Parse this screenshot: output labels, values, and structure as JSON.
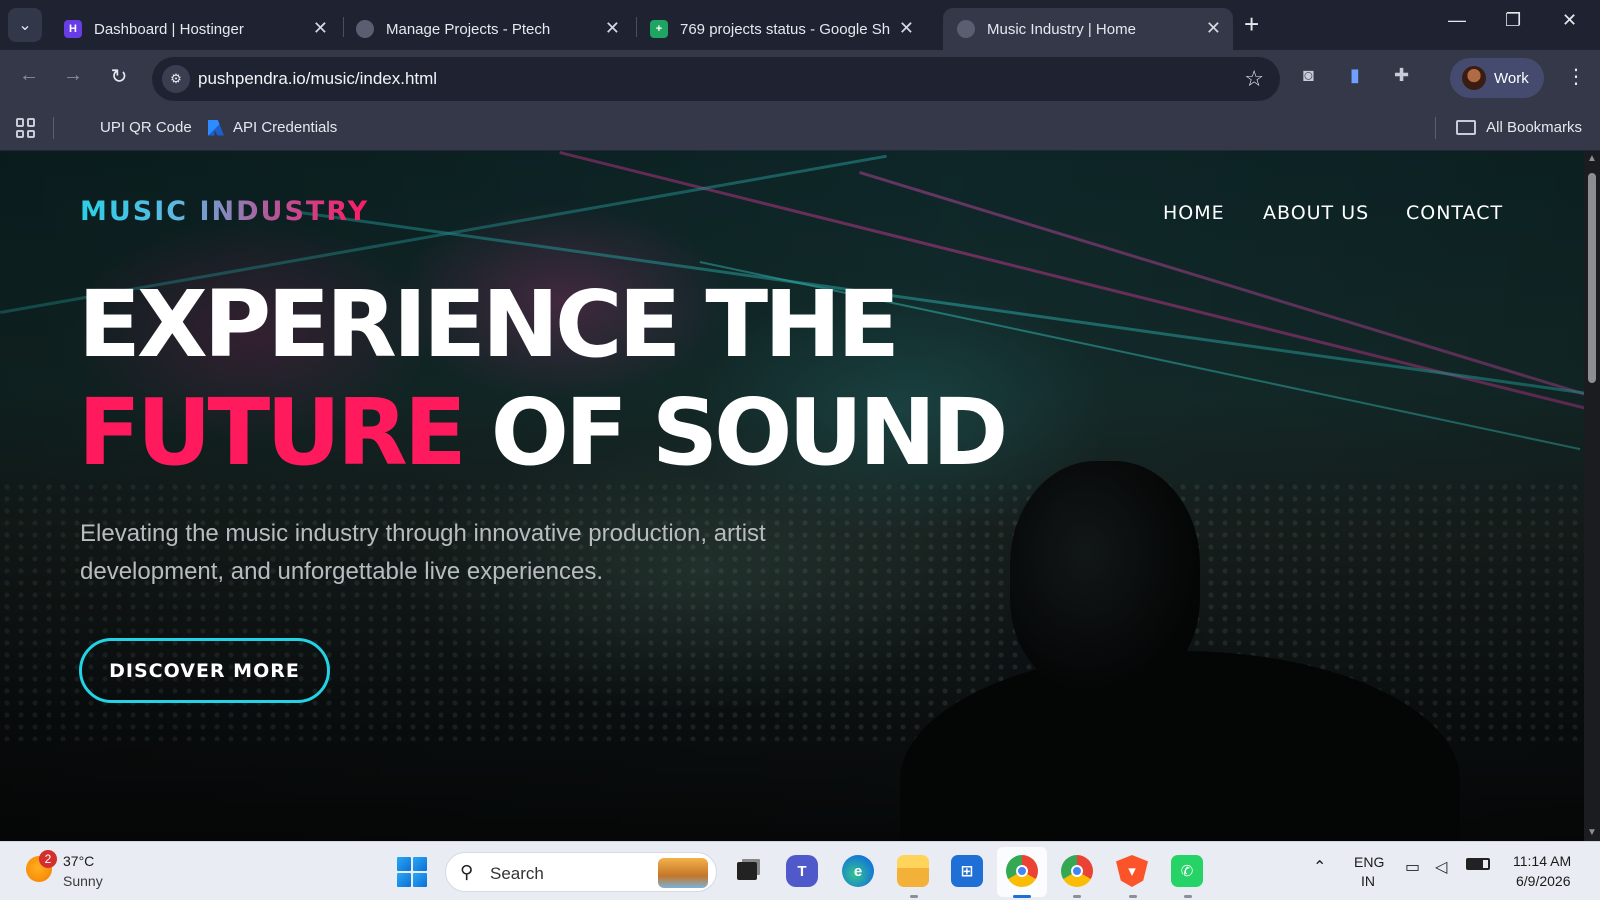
{
  "browser": {
    "tabs": [
      {
        "title": "Dashboard | Hostinger",
        "favicon": "hostinger-icon",
        "active": false
      },
      {
        "title": "Manage Projects - Ptech",
        "favicon": "globe-icon",
        "active": false
      },
      {
        "title": "769 projects status - Google Sh",
        "favicon": "google-sheets-icon",
        "active": false
      },
      {
        "title": "Music Industry | Home",
        "favicon": "globe-icon",
        "active": true
      }
    ],
    "new_tab": "+",
    "window_controls": {
      "minimize": "—",
      "restore": "❐",
      "close": "✕"
    },
    "url": "pushpendra.io/music/index.html",
    "profile_label": "Work",
    "bookmarks": [
      {
        "label": "UPI QR Code",
        "icon": ""
      },
      {
        "label": "API Credentials",
        "icon": "api-credentials-icon"
      }
    ],
    "all_bookmarks": "All Bookmarks"
  },
  "page": {
    "logo": "MUSIC INDUSTRY",
    "nav": [
      "HOME",
      "ABOUT US",
      "CONTACT"
    ],
    "hero": {
      "line1": "EXPERIENCE THE",
      "accent": "FUTURE",
      "line2_rest": "OF SOUND",
      "subtitle": "Elevating the music industry through innovative production, artist development, and unforgettable live experiences.",
      "cta": "DISCOVER MORE"
    },
    "colors": {
      "accent_pink": "#ff1a5e",
      "accent_cyan": "#22d3e6"
    }
  },
  "taskbar": {
    "weather": {
      "badge": "2",
      "temp": "37°C",
      "condition": "Sunny"
    },
    "search_placeholder": "Search",
    "apps": [
      "task-view-icon",
      "teams-icon",
      "edge-icon",
      "file-explorer-icon",
      "microsoft-store-icon",
      "chrome-icon",
      "chrome-profile-icon",
      "brave-icon",
      "whatsapp-icon"
    ],
    "lang": {
      "line1": "ENG",
      "line2": "IN"
    },
    "clock": {
      "time": "11:14 AM",
      "date": "6/9/2026"
    }
  }
}
